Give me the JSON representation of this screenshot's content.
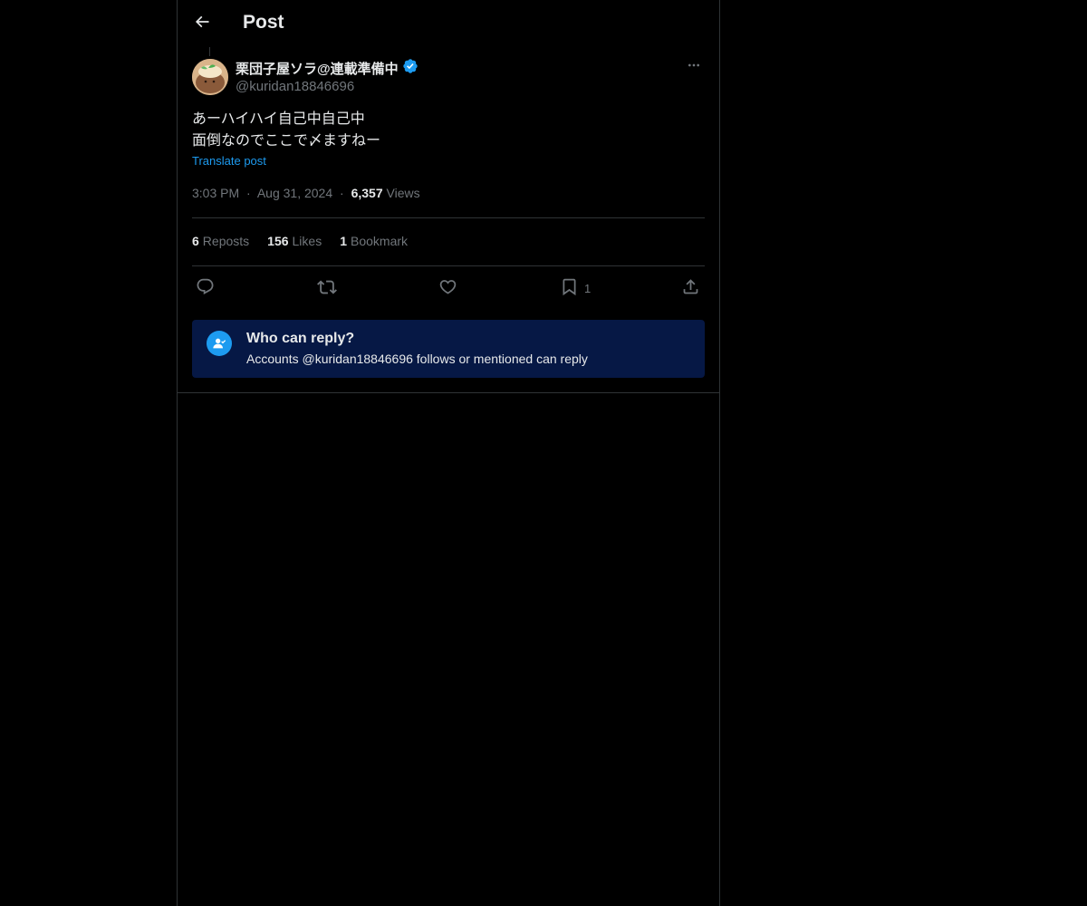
{
  "header": {
    "title": "Post",
    "back_icon": "arrow-left-icon"
  },
  "tweet": {
    "display_name": "栗団子屋ソラ@連載準備中",
    "handle": "@kuridan18846696",
    "verified_icon": "verified-badge-icon",
    "text_lines": [
      "あーハイハイ自己中自己中",
      "面倒なのでここで〆ますねー"
    ],
    "translate_label": "Translate post",
    "time": "3:03 PM",
    "separator": "·",
    "date": "Aug 31, 2024",
    "views_count": "6,357",
    "views_label": "Views"
  },
  "stats": {
    "reposts_count": "6",
    "reposts_label": "Reposts",
    "likes_count": "156",
    "likes_label": "Likes",
    "bookmarks_count": "1",
    "bookmarks_label": "Bookmark"
  },
  "actions": {
    "reply_icon": "reply-icon",
    "repost_icon": "repost-icon",
    "like_icon": "heart-icon",
    "bookmark_icon": "bookmark-icon",
    "bookmark_count": "1",
    "share_icon": "share-icon"
  },
  "reply_restriction": {
    "title": "Who can reply?",
    "description": "Accounts @kuridan18846696 follows or mentioned can reply"
  },
  "colors": {
    "background": "#000000",
    "text": "#e7e9ea",
    "secondary_text": "#71767b",
    "accent": "#1d9bf0",
    "border": "#2f3336",
    "reply_box_bg": "#061845"
  }
}
